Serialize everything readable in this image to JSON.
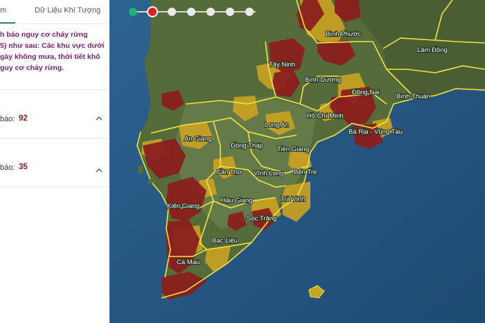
{
  "tabs": {
    "active_label": "m",
    "weather_label": "Dữ Liệu Khí Tượng"
  },
  "warning_lines": [
    "h báo nguy cơ cháy rừng",
    "5) như sau: Các khu vực dưới",
    "gày không mưa, thời tiết khô",
    "guy cơ cháy rừng."
  ],
  "counts": [
    {
      "label": "báo:",
      "value": "92"
    },
    {
      "label": "báo:",
      "value": "35"
    }
  ],
  "icons": {
    "expand": "chevron-up-icon"
  },
  "colors": {
    "high_risk": "#8b1d1d",
    "medium_risk": "#c9a224",
    "border": "#f0e640",
    "water": "#2a5a84",
    "active_step": "#e51d25"
  },
  "stepper": {
    "dots": 7,
    "active_index": 1
  },
  "map": {
    "labels": [
      {
        "id": "lam-dong",
        "text": "Lâm Đồng"
      },
      {
        "id": "binh-phuoc",
        "text": "Bình Phước"
      },
      {
        "id": "tay-ninh",
        "text": "Tây Ninh"
      },
      {
        "id": "binh-duong",
        "text": "Bình Dương"
      },
      {
        "id": "dong-nai",
        "text": "Đồng Nai"
      },
      {
        "id": "binh-thuan",
        "text": "Bình Thuận"
      },
      {
        "id": "ho-chi-minh",
        "text": "Hồ Chí Minh"
      },
      {
        "id": "ba-ria-vung-tau",
        "text": "Bà Rịa - Vũng Tàu"
      },
      {
        "id": "long-an",
        "text": "Long An"
      },
      {
        "id": "an-giang",
        "text": "An Giang"
      },
      {
        "id": "dong-thap",
        "text": "Đồng Tháp"
      },
      {
        "id": "tien-giang",
        "text": "Tiền Giang"
      },
      {
        "id": "can-tho",
        "text": "Cần Thơ"
      },
      {
        "id": "vinh-long",
        "text": "Vĩnh Long"
      },
      {
        "id": "ben-tre",
        "text": "Bến Tre"
      },
      {
        "id": "hau-giang",
        "text": "Hậu Giang"
      },
      {
        "id": "tra-vinh",
        "text": "Trà Vinh"
      },
      {
        "id": "kien-giang",
        "text": "Kiên Giang"
      },
      {
        "id": "soc-trang",
        "text": "Sóc Trăng"
      },
      {
        "id": "bac-lieu",
        "text": "Bạc Liêu"
      },
      {
        "id": "ca-mau",
        "text": "Cà Mau"
      }
    ]
  }
}
